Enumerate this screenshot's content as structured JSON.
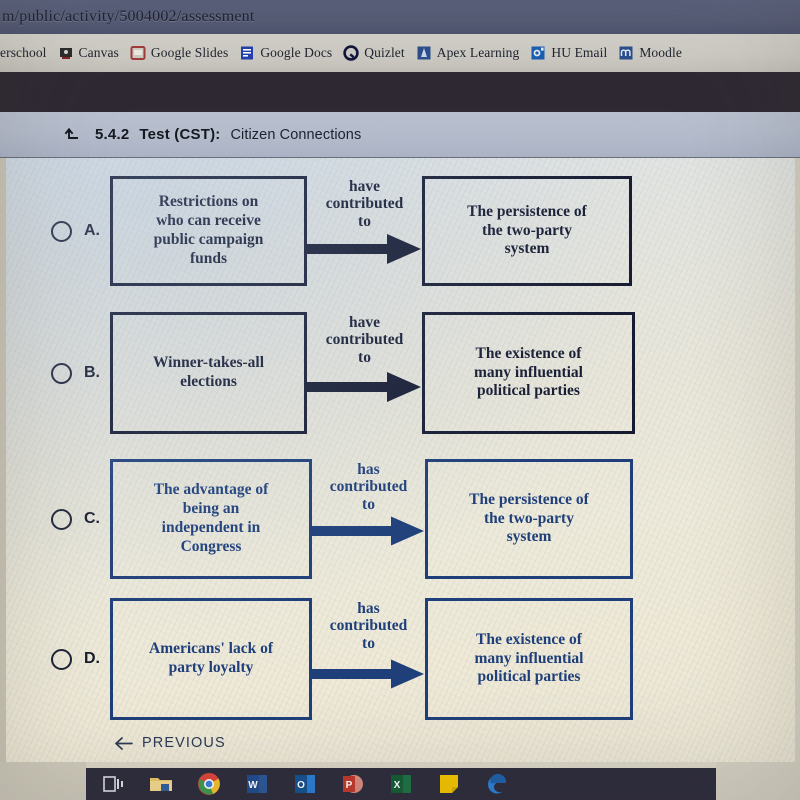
{
  "browser": {
    "url": "m/public/activity/5004002/assessment",
    "bookmarks": [
      {
        "label": "erschool",
        "icon": "powerschool-icon",
        "color": "#1b4f8a"
      },
      {
        "label": "Canvas",
        "icon": "canvas-icon",
        "color": "#2b2b2b"
      },
      {
        "label": "Google Slides",
        "icon": "google-slides-icon",
        "color": "#a23b3b"
      },
      {
        "label": "Google Docs",
        "icon": "google-docs-icon",
        "color": "#2040b0"
      },
      {
        "label": "Quizlet",
        "icon": "quizlet-icon",
        "color": "#12153a"
      },
      {
        "label": "Apex Learning",
        "icon": "apex-learning-icon",
        "color": "#2b4f8e"
      },
      {
        "label": "HU Email",
        "icon": "hu-email-icon",
        "color": "#1a5fb4"
      },
      {
        "label": "Moodle",
        "icon": "moodle-icon",
        "color": "#2a4f8f"
      }
    ]
  },
  "header": {
    "back_icon": "back-up-arrow-icon",
    "code": "5.4.2",
    "test_label": "Test (CST):",
    "title": "Citizen Connections"
  },
  "question": {
    "options": [
      {
        "letter": "A.",
        "cause": "Restrictions on\nwho can receive\npublic campaign\nfunds",
        "connector": "have\ncontributed\nto",
        "effect": "The persistence of\nthe two-party\nsystem",
        "selected": false,
        "ink": "dark"
      },
      {
        "letter": "B.",
        "cause": "Winner-takes-all\nelections",
        "connector": "have\ncontributed\nto",
        "effect": "The existence of\nmany influential\npolitical parties",
        "selected": false,
        "ink": "dark"
      },
      {
        "letter": "C.",
        "cause": "The advantage of\nbeing an\nindependent in\nCongress",
        "connector": "has\ncontributed\nto",
        "effect": "The persistence of\nthe two-party\nsystem",
        "selected": false,
        "ink": "blue"
      },
      {
        "letter": "D.",
        "cause": "Americans' lack of\nparty loyalty",
        "connector": "has\ncontributed\nto",
        "effect": "The existence of\nmany influential\npolitical parties",
        "selected": false,
        "ink": "blue"
      }
    ]
  },
  "footer": {
    "previous_label": "PREVIOUS",
    "previous_icon": "left-arrow-icon"
  },
  "taskbar": {
    "items": [
      {
        "icon": "task-view-icon"
      },
      {
        "icon": "file-explorer-icon"
      },
      {
        "icon": "google-chrome-icon"
      },
      {
        "icon": "microsoft-word-icon"
      },
      {
        "icon": "microsoft-outlook-icon"
      },
      {
        "icon": "microsoft-powerpoint-icon"
      },
      {
        "icon": "microsoft-excel-icon"
      },
      {
        "icon": "sticky-notes-icon"
      },
      {
        "icon": "microsoft-edge-icon"
      }
    ]
  },
  "colors": {
    "ink_dark": "#161b31",
    "ink_blue": "#1f3f7a",
    "header_bar": "#b4bccc",
    "omnibox": "#575e79"
  }
}
